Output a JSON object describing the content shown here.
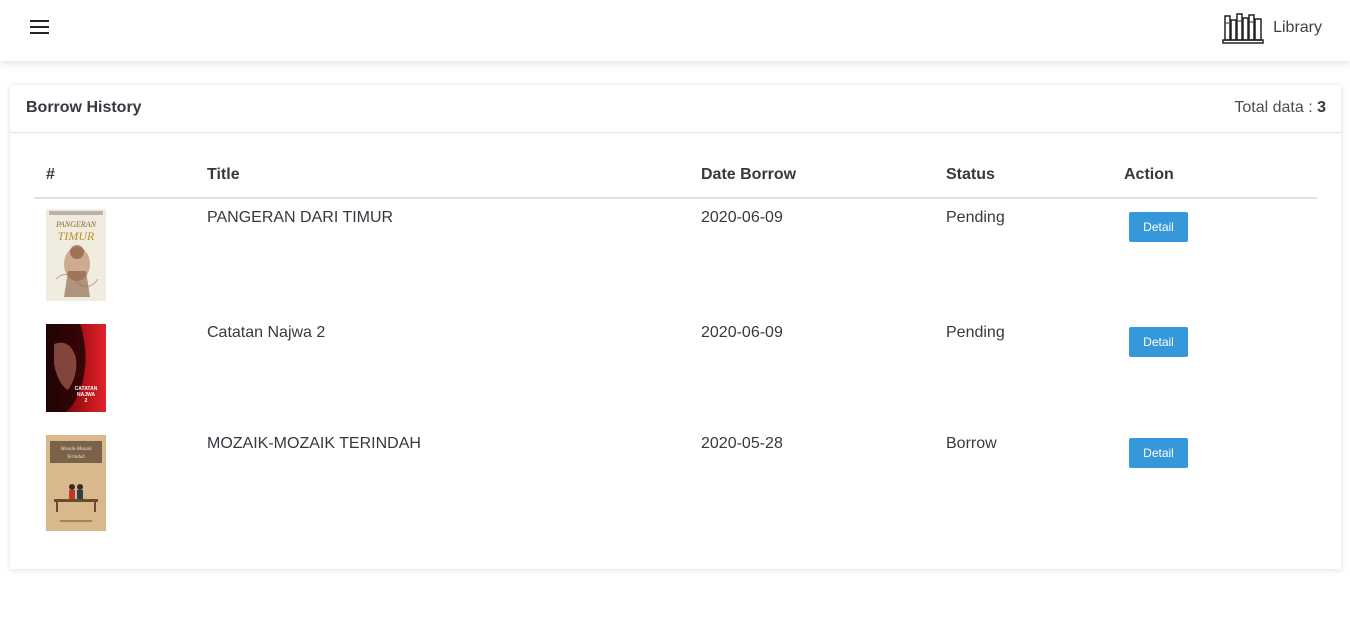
{
  "navbar": {
    "menu_icon": "hamburger-menu-icon",
    "brand_icon": "bookshelf-icon",
    "brand_label": "Library"
  },
  "card": {
    "title": "Borrow History",
    "total_label": "Total data :",
    "total_value": "3"
  },
  "table": {
    "headers": [
      "#",
      "Title",
      "Date Borrow",
      "Status",
      "Action"
    ],
    "rows": [
      {
        "cover_icon": "book-cover-pangeran-dari-timur",
        "title": "PANGERAN DARI TIMUR",
        "date": "2020-06-09",
        "status": "Pending",
        "action": "Detail"
      },
      {
        "cover_icon": "book-cover-catatan-najwa-2",
        "title": "Catatan Najwa 2",
        "date": "2020-06-09",
        "status": "Pending",
        "action": "Detail"
      },
      {
        "cover_icon": "book-cover-mozaik-mozaik-terindah",
        "title": "MOZAIK-MOZAIK TERINDAH",
        "date": "2020-05-28",
        "status": "Borrow",
        "action": "Detail"
      }
    ]
  },
  "colors": {
    "primary_button": "#3498db",
    "text": "#343a40"
  }
}
